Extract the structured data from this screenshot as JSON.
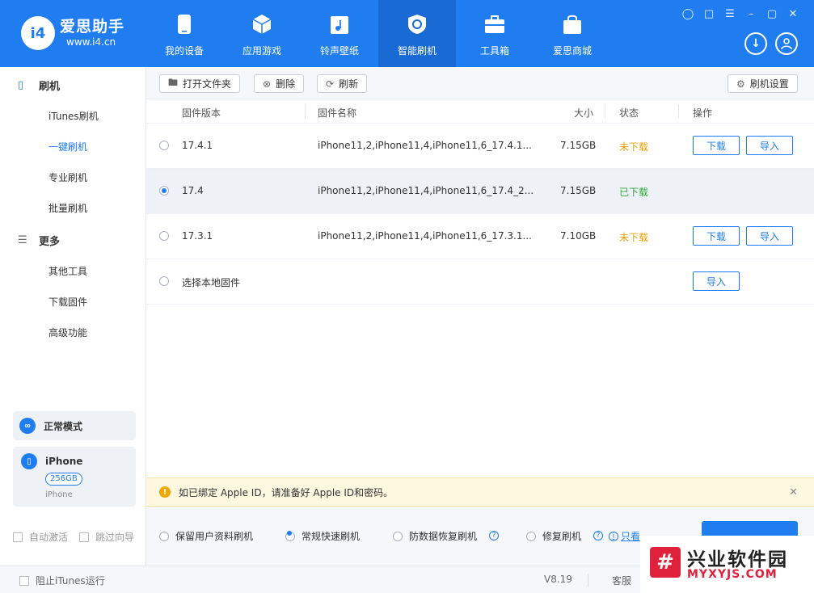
{
  "app": {
    "logo_mark": "i4",
    "logo_title": "爱思助手",
    "logo_url": "www.i4.cn"
  },
  "nav": [
    {
      "label": "我的设备",
      "icon": "phone-icon"
    },
    {
      "label": "应用游戏",
      "icon": "cube-icon"
    },
    {
      "label": "铃声壁纸",
      "icon": "music-folder-icon"
    },
    {
      "label": "智能刷机",
      "icon": "flash-icon",
      "active": true
    },
    {
      "label": "工具箱",
      "icon": "toolbox-icon"
    },
    {
      "label": "爱思商城",
      "icon": "shopping-bag-icon"
    }
  ],
  "window_controls": [
    "shirt-icon",
    "clipboard-icon",
    "menu-icon",
    "minimize-icon",
    "maximize-icon",
    "close-icon"
  ],
  "sidebar": {
    "group_flash": "刷机",
    "items_flash": [
      "iTunes刷机",
      "一键刷机",
      "专业刷机",
      "批量刷机"
    ],
    "group_more": "更多",
    "items_more": [
      "其他工具",
      "下载固件",
      "高级功能"
    ],
    "mode": "正常模式",
    "device": {
      "name": "iPhone",
      "capacity": "256GB",
      "type": "iPhone"
    },
    "auto_activate": "自动激活",
    "skip_guide": "跳过向导"
  },
  "toolbar": {
    "open_folder": "打开文件夹",
    "delete": "删除",
    "refresh": "刷新",
    "settings": "刷机设置"
  },
  "table": {
    "headers": {
      "version": "固件版本",
      "name": "固件名称",
      "size": "大小",
      "status": "状态",
      "action": "操作"
    },
    "rows": [
      {
        "version": "17.4.1",
        "name": "iPhone11,2,iPhone11,4,iPhone11,6_17.4.1...",
        "size": "7.15GB",
        "status": "未下载",
        "download": "下载",
        "import": "导入"
      },
      {
        "version": "17.4",
        "name": "iPhone11,2,iPhone11,4,iPhone11,6_17.4_2...",
        "size": "7.15GB",
        "status": "已下载"
      },
      {
        "version": "17.3.1",
        "name": "iPhone11,2,iPhone11,4,iPhone11,6_17.3.1...",
        "size": "7.10GB",
        "status": "未下载",
        "download": "下载",
        "import": "导入"
      }
    ],
    "local": {
      "label": "选择本地固件",
      "import": "导入"
    }
  },
  "notice": "如已绑定 Apple ID，请准备好 Apple ID和密码。",
  "options": {
    "keep_data": "保留用户资料刷机",
    "normal_fast": "常规快速刷机",
    "anti_recovery": "防数据恢复刷机",
    "repair": "修复刷机",
    "readonly": "只看"
  },
  "statusbar": {
    "block_itunes": "阻止iTunes运行",
    "version": "V8.19",
    "service": "客服"
  },
  "watermark": {
    "mark": "#",
    "cn": "兴业软件园",
    "en": "MYXYJS.COM"
  },
  "colors": {
    "accent": "#1f7df0",
    "warning": "#e6a100",
    "success": "#2fa836",
    "notice_bg": "#fff8e0"
  }
}
